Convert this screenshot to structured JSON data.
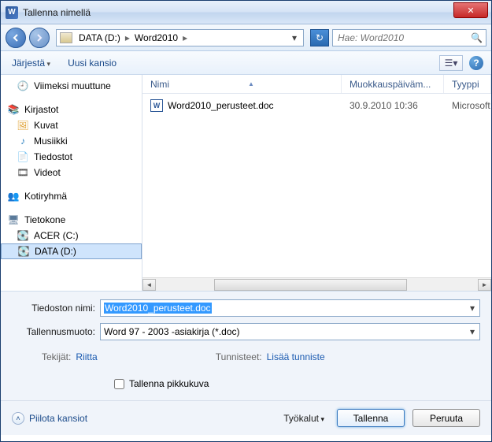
{
  "window": {
    "title": "Tallenna nimellä",
    "app_icon_letter": "W"
  },
  "nav": {
    "crumbs": [
      "DATA (D:)",
      "Word2010"
    ],
    "search_placeholder": "Hae: Word2010"
  },
  "toolbar": {
    "organize": "Järjestä",
    "new_folder": "Uusi kansio"
  },
  "sidebar": {
    "recent": "Viimeksi muuttune",
    "libraries": "Kirjastot",
    "pictures": "Kuvat",
    "music": "Musiikki",
    "documents": "Tiedostot",
    "videos": "Videot",
    "homegroup": "Kotiryhmä",
    "computer": "Tietokone",
    "drive_c": "ACER (C:)",
    "drive_d": "DATA (D:)"
  },
  "columns": {
    "name": "Nimi",
    "date": "Muokkauspäiväm...",
    "type": "Tyyppi"
  },
  "files": [
    {
      "name": "Word2010_perusteet.doc",
      "date": "30.9.2010 10:36",
      "type": "Microsoft"
    }
  ],
  "fields": {
    "filename_label": "Tiedoston nimi:",
    "filename_value": "Word2010_perusteet.doc",
    "filetype_label": "Tallennusmuoto:",
    "filetype_value": "Word 97 - 2003 -asiakirja (*.doc)",
    "authors_label": "Tekijät:",
    "authors_value": "Riitta",
    "tags_label": "Tunnisteet:",
    "tags_value": "Lisää tunniste",
    "save_thumbnail": "Tallenna pikkukuva"
  },
  "footer": {
    "hide_folders": "Piilota kansiot",
    "tools": "Työkalut",
    "save": "Tallenna",
    "cancel": "Peruuta"
  }
}
